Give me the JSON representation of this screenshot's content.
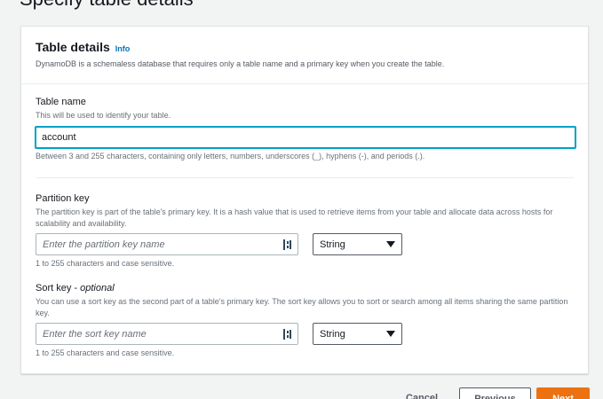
{
  "page": {
    "heading": "Specify table details"
  },
  "panel": {
    "title": "Table details",
    "info_link": "Info",
    "description": "DynamoDB is a schemaless database that requires only a table name and a primary key when you create the table."
  },
  "table_name": {
    "label": "Table name",
    "description": "This will be used to identify your table.",
    "value": "account",
    "constraint": "Between 3 and 255 characters, containing only letters, numbers, underscores (_), hyphens (-), and periods (.)."
  },
  "partition_key": {
    "label": "Partition key",
    "description": "The partition key is part of the table's primary key. It is a hash value that is used to retrieve items from your table and allocate data across hosts for scalability and availability.",
    "placeholder": "Enter the partition key name",
    "type_value": "String",
    "constraint": "1 to 255 characters and case sensitive."
  },
  "sort_key": {
    "label": "Sort key",
    "label_optional": "optional",
    "label_separator": " - ",
    "description": "You can use a sort key as the second part of a table's primary key. The sort key allows you to sort or search among all items sharing the same partition key.",
    "placeholder": "Enter the sort key name",
    "type_value": "String",
    "constraint": "1 to 255 characters and case sensitive."
  },
  "footer": {
    "cancel_label": "Cancel",
    "previous_label": "Previous",
    "next_label": "Next"
  },
  "colors": {
    "accent": "#ec7211",
    "link": "#0073bb",
    "focus": "#00a1c9"
  },
  "icons": {
    "key_input_icon": "keyboard-shortcut-icon",
    "select_caret": "caret-down-icon"
  }
}
